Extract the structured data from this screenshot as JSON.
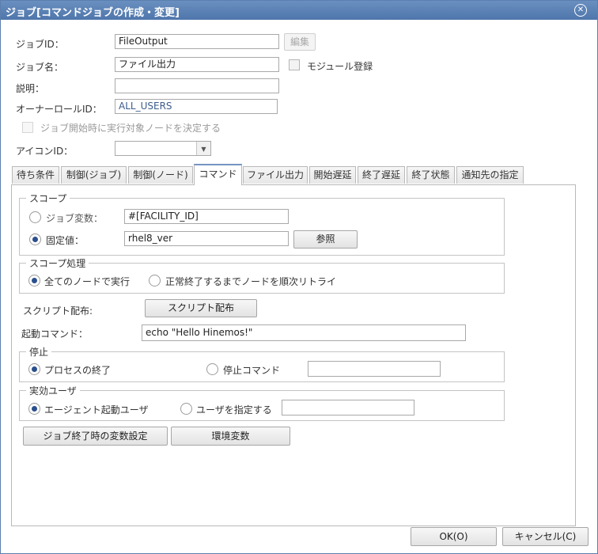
{
  "window": {
    "title": "ジョブ[コマンドジョブの作成・変更]"
  },
  "form": {
    "job_id_label": "ジョブID：",
    "job_id_value": "FileOutput",
    "edit_button": "編集",
    "job_name_label": "ジョブ名：",
    "job_name_value": "ファイル出力",
    "module_register_label": "モジュール登録",
    "description_label": "説明：",
    "description_value": "",
    "owner_role_label": "オーナーロールID：",
    "owner_role_value": "ALL_USERS",
    "decide_node_label": "ジョブ開始時に実行対象ノードを決定する",
    "icon_id_label": "アイコンID：",
    "icon_id_value": ""
  },
  "tabs": [
    {
      "label": "待ち条件"
    },
    {
      "label": "制御(ジョブ)"
    },
    {
      "label": "制御(ノード)"
    },
    {
      "label": "コマンド"
    },
    {
      "label": "ファイル出力"
    },
    {
      "label": "開始遅延"
    },
    {
      "label": "終了遅延"
    },
    {
      "label": "終了状態"
    },
    {
      "label": "通知先の指定"
    }
  ],
  "active_tab": "コマンド",
  "scope": {
    "title": "スコープ",
    "job_var_label": "ジョブ変数：",
    "job_var_value": "#[FACILITY_ID]",
    "fixed_label": "固定値：",
    "fixed_value": "rhel8_ver",
    "ref_button": "参照",
    "selected": "fixed"
  },
  "scope_processing": {
    "title": "スコープ処理",
    "opt_all": "全てのノードで実行",
    "opt_retry": "正常終了するまでノードを順次リトライ",
    "selected": "all"
  },
  "script": {
    "label": "スクリプト配布:",
    "button": "スクリプト配布"
  },
  "start_command": {
    "label": "起動コマンド：",
    "value": "echo \"Hello Hinemos!\""
  },
  "stop": {
    "title": "停止",
    "opt_process": "プロセスの終了",
    "opt_command": "停止コマンド",
    "command_value": "",
    "selected": "process"
  },
  "effective_user": {
    "title": "実効ユーザ",
    "opt_agent": "エージェント起動ユーザ",
    "opt_specify": "ユーザを指定する",
    "user_value": "",
    "selected": "agent"
  },
  "bottom_buttons": {
    "var_setting": "ジョブ終了時の変数設定",
    "env_var": "環境変数"
  },
  "footer": {
    "ok": "OK(O)",
    "cancel": "キャンセル(C)"
  }
}
